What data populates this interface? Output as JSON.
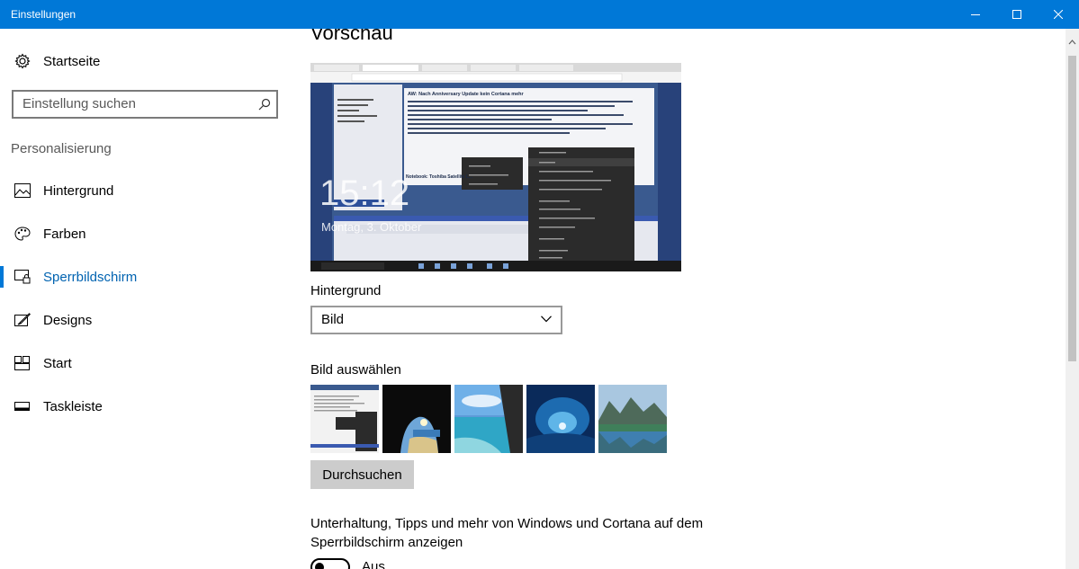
{
  "window": {
    "title": "Einstellungen",
    "accent": "#0078d7"
  },
  "sidebar": {
    "home_label": "Startseite",
    "search_placeholder": "Einstellung suchen",
    "section_header": "Personalisierung",
    "items": [
      {
        "label": "Hintergrund",
        "icon": "picture-icon"
      },
      {
        "label": "Farben",
        "icon": "palette-icon"
      },
      {
        "label": "Sperrbildschirm",
        "icon": "lock-screen-icon",
        "active": true
      },
      {
        "label": "Designs",
        "icon": "brush-icon"
      },
      {
        "label": "Start",
        "icon": "start-icon"
      },
      {
        "label": "Taskleiste",
        "icon": "taskbar-icon"
      }
    ]
  },
  "main": {
    "preview_heading": "Vorschau",
    "preview": {
      "time": "15:12",
      "date": "Montag, 3. Oktober",
      "post_title": "AW: Nach Anniversary Update kein Cortana mehr",
      "post_notebook": "Notebook: Toshiba Satellite L..."
    },
    "background_label": "Hintergrund",
    "background_value": "Bild",
    "choose_image_label": "Bild auswählen",
    "browse_button": "Durchsuchen",
    "fun_facts_text": "Unterhaltung, Tipps und mehr von Windows und Cortana auf dem Sperrbildschirm anzeigen",
    "toggle_state": "Aus"
  }
}
